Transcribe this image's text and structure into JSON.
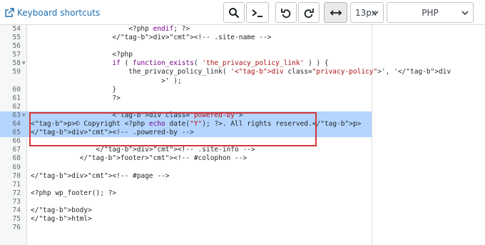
{
  "toolbar": {
    "keyboard_shortcuts_label": "Keyboard shortcuts",
    "font_size": "13px",
    "language": "PHP"
  },
  "editor": {
    "lines": [
      {
        "num": "54",
        "indent": 24,
        "text": "<?php endif; ?>",
        "fold": false,
        "highlight": false
      },
      {
        "num": "55",
        "indent": 20,
        "text": "</div><!-- .site-name -->",
        "fold": false,
        "highlight": false
      },
      {
        "num": "56",
        "indent": 0,
        "text": "",
        "fold": false,
        "highlight": false
      },
      {
        "num": "57",
        "indent": 20,
        "text": "<?php",
        "fold": false,
        "highlight": false
      },
      {
        "num": "58",
        "indent": 20,
        "text": "if ( function_exists( 'the_privacy_policy_link' ) ) {",
        "fold": true,
        "highlight": false
      },
      {
        "num": "59",
        "indent": 24,
        "text": "the_privacy_policy_link( '<div class=\"privacy-policy\">', '</div",
        "fold": false,
        "highlight": false
      },
      {
        "num": "",
        "indent": 32,
        "text": ">' );",
        "fold": false,
        "highlight": false
      },
      {
        "num": "60",
        "indent": 20,
        "text": "}",
        "fold": false,
        "highlight": false
      },
      {
        "num": "61",
        "indent": 20,
        "text": "?>",
        "fold": false,
        "highlight": false
      },
      {
        "num": "62",
        "indent": 0,
        "text": "",
        "fold": false,
        "highlight": false
      },
      {
        "num": "63",
        "indent": 20,
        "text": "<div class=\"powered-by\">",
        "fold": true,
        "highlight": true
      },
      {
        "num": "64",
        "indent": 0,
        "text": "<p>© Copyright <?php echo date(\"Y\"); ?>. All rights reserved.</p>",
        "fold": false,
        "highlight": true
      },
      {
        "num": "65",
        "indent": 0,
        "text": "</div><!-- .powered-by -->",
        "fold": false,
        "highlight": true
      },
      {
        "num": "66",
        "indent": 0,
        "text": "",
        "fold": false,
        "highlight": false
      },
      {
        "num": "67",
        "indent": 16,
        "text": "</div><!-- .site-info -->",
        "fold": false,
        "highlight": false
      },
      {
        "num": "68",
        "indent": 12,
        "text": "</footer><!-- #colophon -->",
        "fold": false,
        "highlight": false
      },
      {
        "num": "69",
        "indent": 0,
        "text": "",
        "fold": false,
        "highlight": false
      },
      {
        "num": "70",
        "indent": 0,
        "text": "</div><!-- #page -->",
        "fold": false,
        "highlight": false
      },
      {
        "num": "71",
        "indent": 0,
        "text": "",
        "fold": false,
        "highlight": false
      },
      {
        "num": "72",
        "indent": 0,
        "text": "<?php wp_footer(); ?>",
        "fold": false,
        "highlight": false
      },
      {
        "num": "73",
        "indent": 0,
        "text": "",
        "fold": false,
        "highlight": false
      },
      {
        "num": "74",
        "indent": 0,
        "text": "</body>",
        "fold": false,
        "highlight": false
      },
      {
        "num": "75",
        "indent": 0,
        "text": "</html>",
        "fold": false,
        "highlight": false
      },
      {
        "num": "76",
        "indent": 0,
        "text": "",
        "fold": false,
        "highlight": false
      }
    ]
  },
  "colors": {
    "accent": "#2271b1",
    "selection": "#b4d5fe",
    "annotation_box": "#d63638"
  }
}
